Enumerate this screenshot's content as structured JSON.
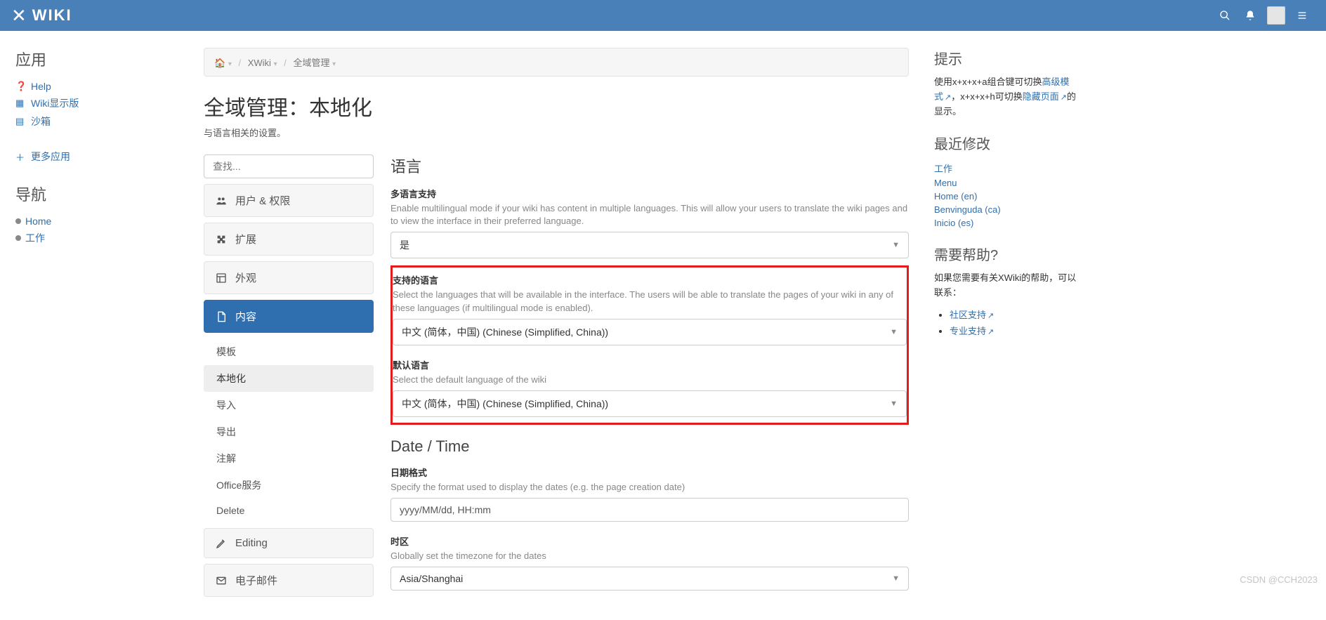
{
  "header": {
    "brand": "WIKI"
  },
  "leftPanel": {
    "apps_title": "应用",
    "help": "Help",
    "wiki_display": "Wiki显示版",
    "sandbox": "沙箱",
    "more_apps": "更多应用",
    "nav_title": "导航",
    "nav_home": "Home",
    "nav_work": "工作"
  },
  "breadcrumb": {
    "xwiki": "XWiki",
    "global_admin": "全域管理"
  },
  "page": {
    "title": "全域管理：本地化",
    "subtitle": "与语言相关的设置。"
  },
  "adminNav": {
    "search_placeholder": "查找...",
    "users": "用户 & 权限",
    "extensions": "扩展",
    "look": "外观",
    "content": "内容",
    "sub_templates": "模板",
    "sub_localization": "本地化",
    "sub_import": "导入",
    "sub_export": "导出",
    "sub_annotations": "注解",
    "sub_office": "Office服务",
    "sub_delete": "Delete",
    "editing": "Editing",
    "email": "电子邮件"
  },
  "lang": {
    "section_title": "语言",
    "multi_label": "多语言支持",
    "multi_desc": "Enable multilingual mode if your wiki has content in multiple languages. This will allow your users to translate the wiki pages and to view the interface in their preferred language.",
    "multi_value": "是",
    "supported_label": "支持的语言",
    "supported_desc": "Select the languages that will be available in the interface. The users will be able to translate the pages of your wiki in any of these languages (if multilingual mode is enabled).",
    "supported_value": "中文 (简体，中国) (Chinese (Simplified, China))",
    "default_label": "默认语言",
    "default_desc": "Select the default language of the wiki",
    "default_value": "中文 (简体，中国) (Chinese (Simplified, China))"
  },
  "datetime": {
    "section_title": "Date / Time",
    "date_label": "日期格式",
    "date_desc": "Specify the format used to display the dates (e.g. the page creation date)",
    "date_value": "yyyy/MM/dd, HH:mm",
    "tz_label": "时区",
    "tz_desc": "Globally set the timezone for the dates",
    "tz_value": "Asia/Shanghai"
  },
  "tips": {
    "title": "提示",
    "text1a": "使用x+x+x+a组合键可切换",
    "link1": "高级模式",
    "text1b": "，x+x+x+h可切换",
    "link2": "隐藏页面",
    "text1c": "的显示。"
  },
  "recent": {
    "title": "最近修改",
    "items": [
      "工作",
      "Menu",
      "Home (en)",
      "Benvinguda (ca)",
      "Inicio (es)"
    ]
  },
  "help": {
    "title": "需要帮助?",
    "text": "如果您需要有关XWiki的帮助，可以联系：",
    "community": "社区支持",
    "pro": "专业支持"
  },
  "watermark": "CSDN @CCH2023"
}
